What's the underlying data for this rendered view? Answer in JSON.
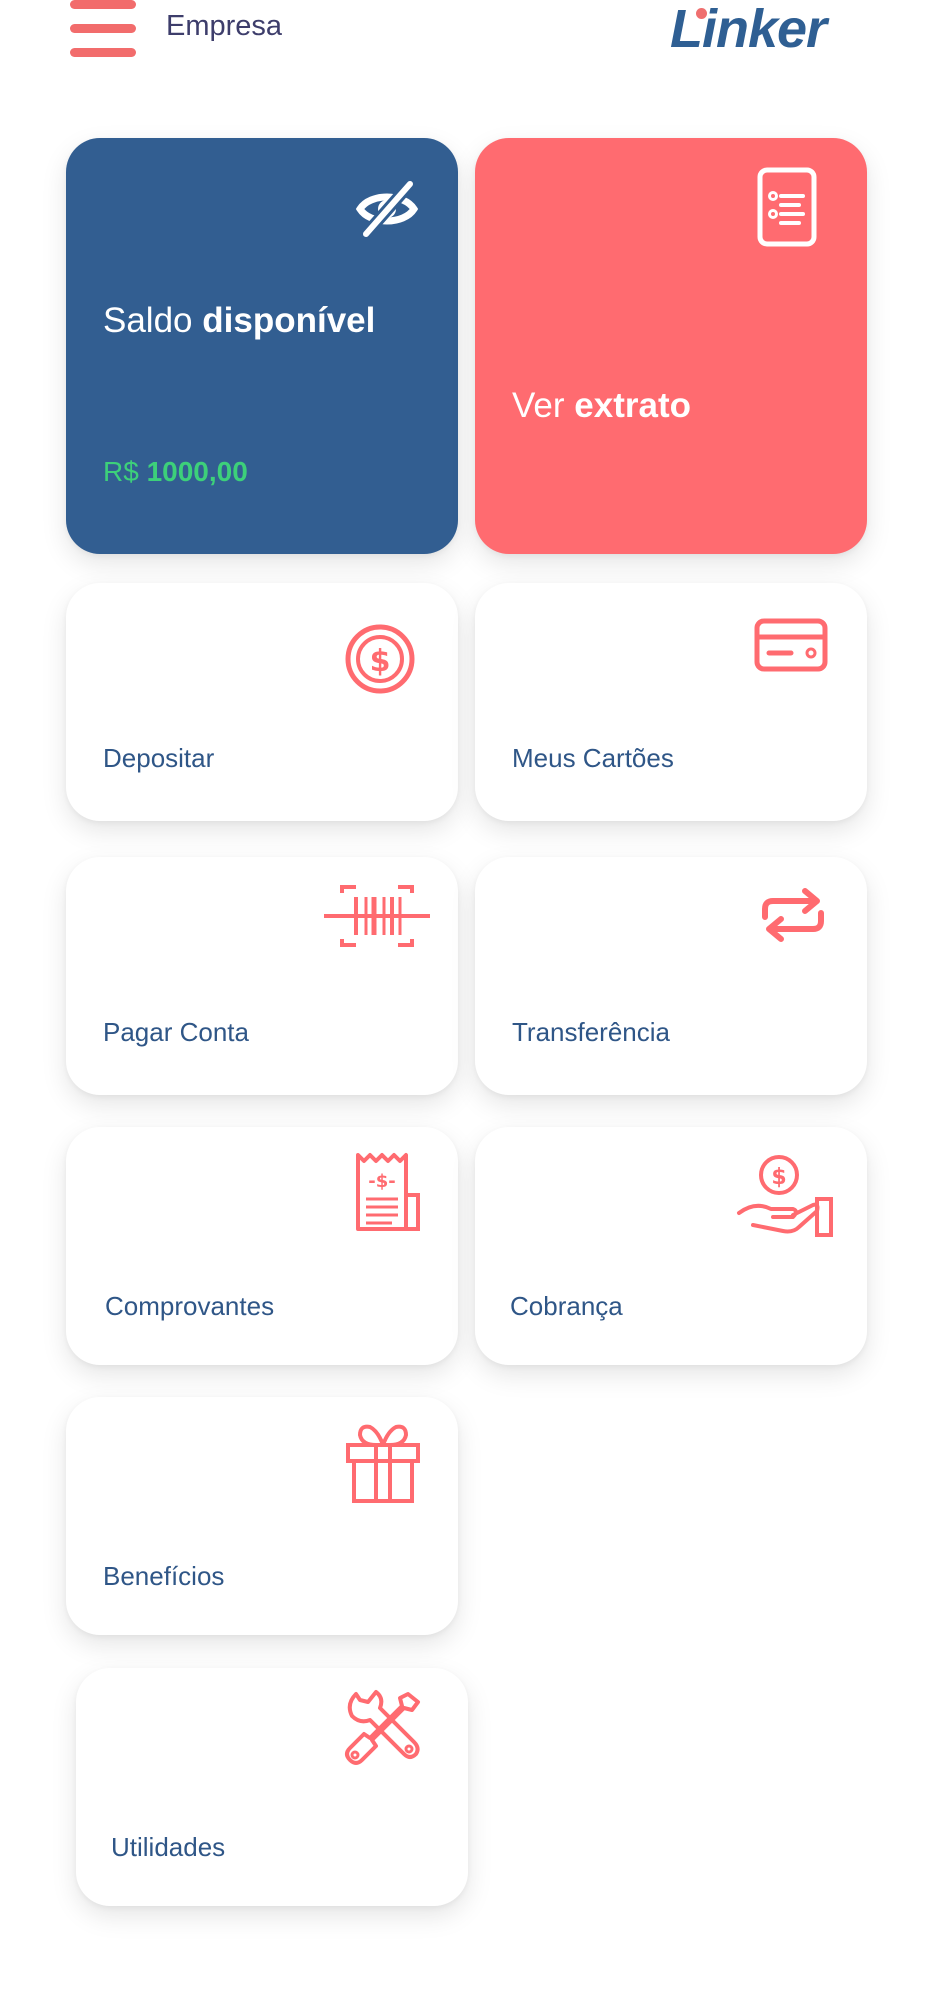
{
  "header": {
    "company_label": "Empresa",
    "logo_text": "Linker"
  },
  "balance_card": {
    "title_regular": "Saldo",
    "title_bold": "disponível",
    "currency": "R$",
    "amount": "1000,00",
    "icon": "eye-slash-icon"
  },
  "statement_card": {
    "title_regular": "Ver",
    "title_bold": "extrato",
    "icon": "document-list-icon"
  },
  "menu": [
    {
      "label": "Depositar",
      "icon": "dollar-circle-icon"
    },
    {
      "label": "Meus Cartões",
      "icon": "credit-card-icon"
    },
    {
      "label": "Pagar Conta",
      "icon": "barcode-scan-icon"
    },
    {
      "label": "Transferência",
      "icon": "transfer-arrows-icon"
    },
    {
      "label": "Comprovantes",
      "icon": "receipt-icon"
    },
    {
      "label": "Cobrança",
      "icon": "hand-coin-icon"
    },
    {
      "label": "Benefícios",
      "icon": "gift-icon"
    },
    {
      "label": "Utilidades",
      "icon": "tools-icon"
    }
  ],
  "colors": {
    "primary_blue": "#325e91",
    "accent_red": "#ff6b70",
    "balance_green": "#3dd07a",
    "label_blue": "#2f5687"
  }
}
